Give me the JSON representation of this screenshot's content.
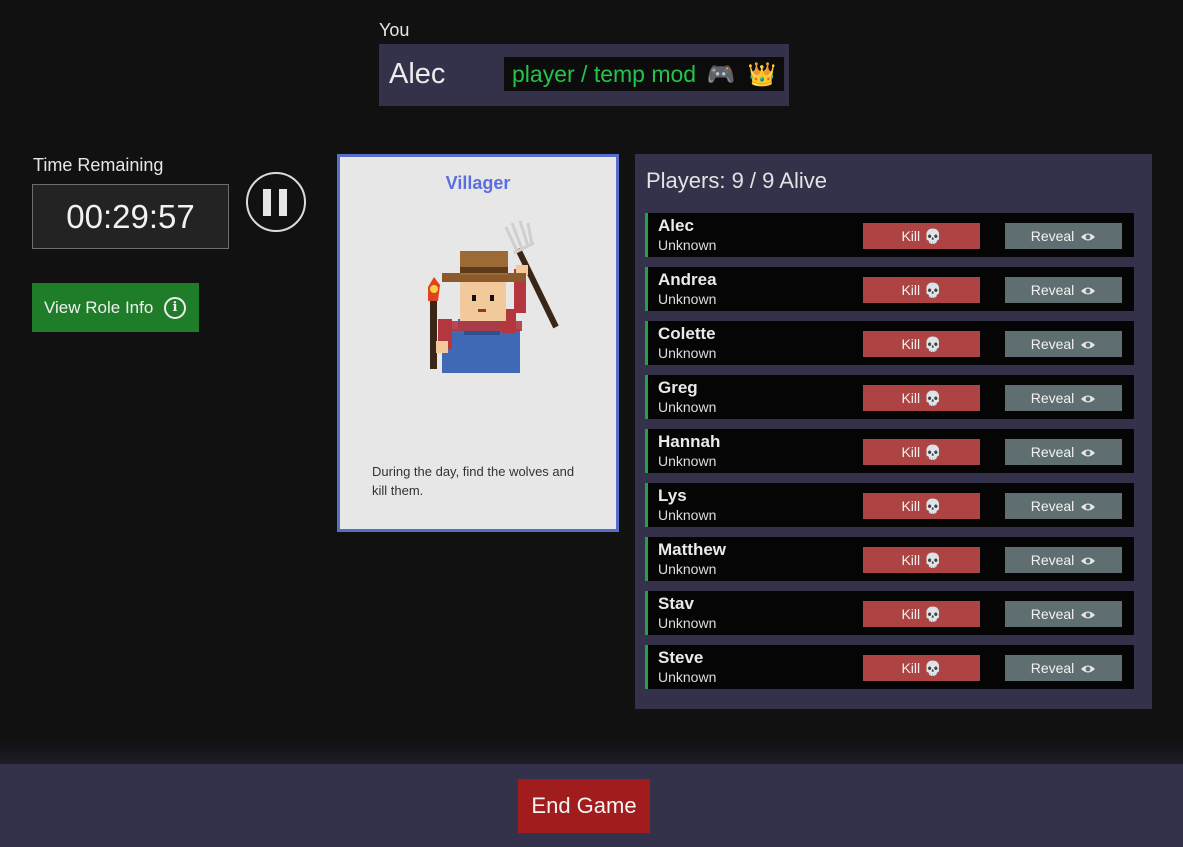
{
  "you": {
    "label": "You",
    "name": "Alec",
    "role_tag": "player / temp mod",
    "role_icons": [
      "🎮",
      "👑"
    ]
  },
  "timer": {
    "label": "Time Remaining",
    "value": "00:29:57"
  },
  "controls": {
    "pause_icon": "pause-icon",
    "view_role_info_label": "View Role Info",
    "info_icon": "ⓘ"
  },
  "card": {
    "title": "Villager",
    "description": "During the day, find the wolves and kill them."
  },
  "players_panel": {
    "title": "Players: 9 / 9 Alive",
    "kill_label": "Kill",
    "kill_icon": "💀",
    "reveal_label": "Reveal",
    "players": [
      {
        "name": "Alec",
        "status": "Unknown"
      },
      {
        "name": "Andrea",
        "status": "Unknown"
      },
      {
        "name": "Colette",
        "status": "Unknown"
      },
      {
        "name": "Greg",
        "status": "Unknown"
      },
      {
        "name": "Hannah",
        "status": "Unknown"
      },
      {
        "name": "Lys",
        "status": "Unknown"
      },
      {
        "name": "Matthew",
        "status": "Unknown"
      },
      {
        "name": "Stav",
        "status": "Unknown"
      },
      {
        "name": "Steve",
        "status": "Unknown"
      }
    ]
  },
  "footer": {
    "end_game_label": "End Game"
  },
  "colors": {
    "panel": "#34324a",
    "alive_green": "#23a146",
    "kill_red": "#ad4343",
    "reveal_gray": "#5f6f71",
    "end_red": "#a11c1c",
    "card_border": "#5a6dc9"
  }
}
